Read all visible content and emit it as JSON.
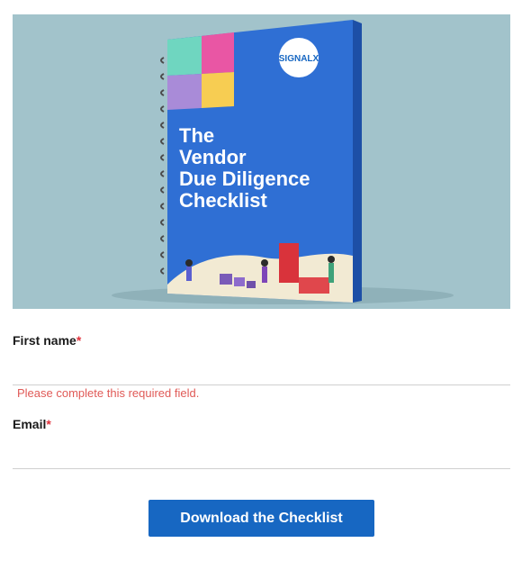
{
  "hero": {
    "logo_text": "SIGNALX",
    "book_title_lines": [
      "The",
      "Vendor",
      "Due Diligence",
      "Checklist"
    ]
  },
  "form": {
    "first_name": {
      "label": "First name",
      "required_mark": "*",
      "value": "",
      "placeholder": ""
    },
    "first_name_error": "Please complete this required field.",
    "email": {
      "label": "Email",
      "required_mark": "*",
      "value": "",
      "placeholder": ""
    },
    "submit_label": "Download the Checklist"
  },
  "colors": {
    "accent": "#1767c2",
    "required": "#e0323c",
    "error": "#e05a57",
    "hero_bg": "#a2c3cb",
    "book_cover": "#2f6fd4"
  }
}
